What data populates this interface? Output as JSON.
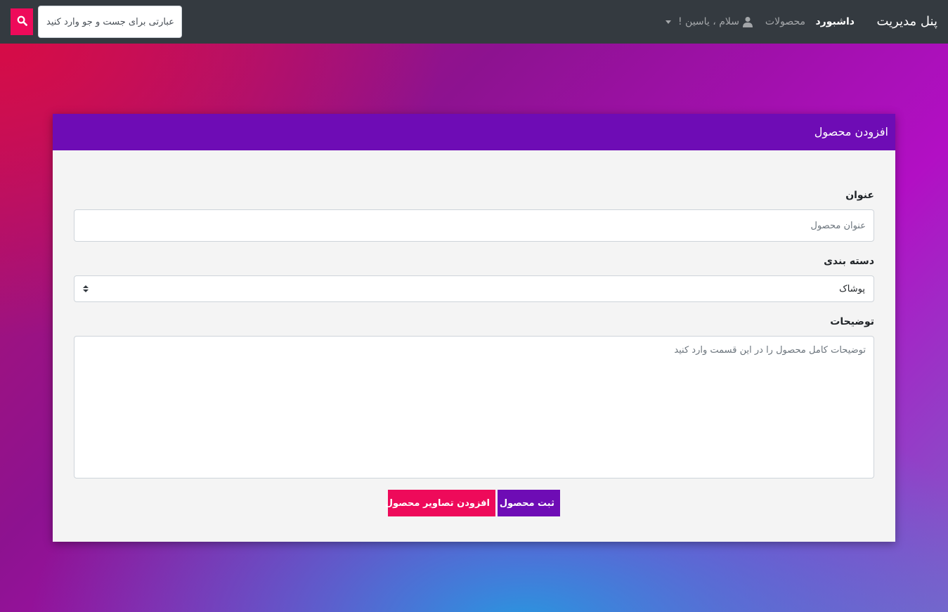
{
  "navbar": {
    "brand": "پنل مدیریت",
    "dashboard_label": "داشبورد",
    "products_label": "محصولات",
    "user_greeting": "سلام ، یاسین !",
    "search_placeholder": "عبارتی برای جست و جو وارد کنید"
  },
  "card": {
    "title": "افزودن محصول",
    "fields": {
      "title_label": "عنوان",
      "title_placeholder": "عنوان محصول",
      "category_label": "دسته بندی",
      "category_value": "پوشاک",
      "description_label": "توضیحات",
      "description_placeholder": "توضیحات کامل محصول را در این قسمت وارد کنید"
    },
    "buttons": {
      "submit_label": "ثبت محصول",
      "add_images_label": "افزودن تصاویر محصول"
    }
  },
  "colors": {
    "navbar": "#343a40",
    "primary": "#6e0cb5",
    "accent": "#ee0a5a"
  },
  "icons": [
    "search-icon",
    "user-icon",
    "caret-down-icon",
    "select-arrows-icon"
  ]
}
